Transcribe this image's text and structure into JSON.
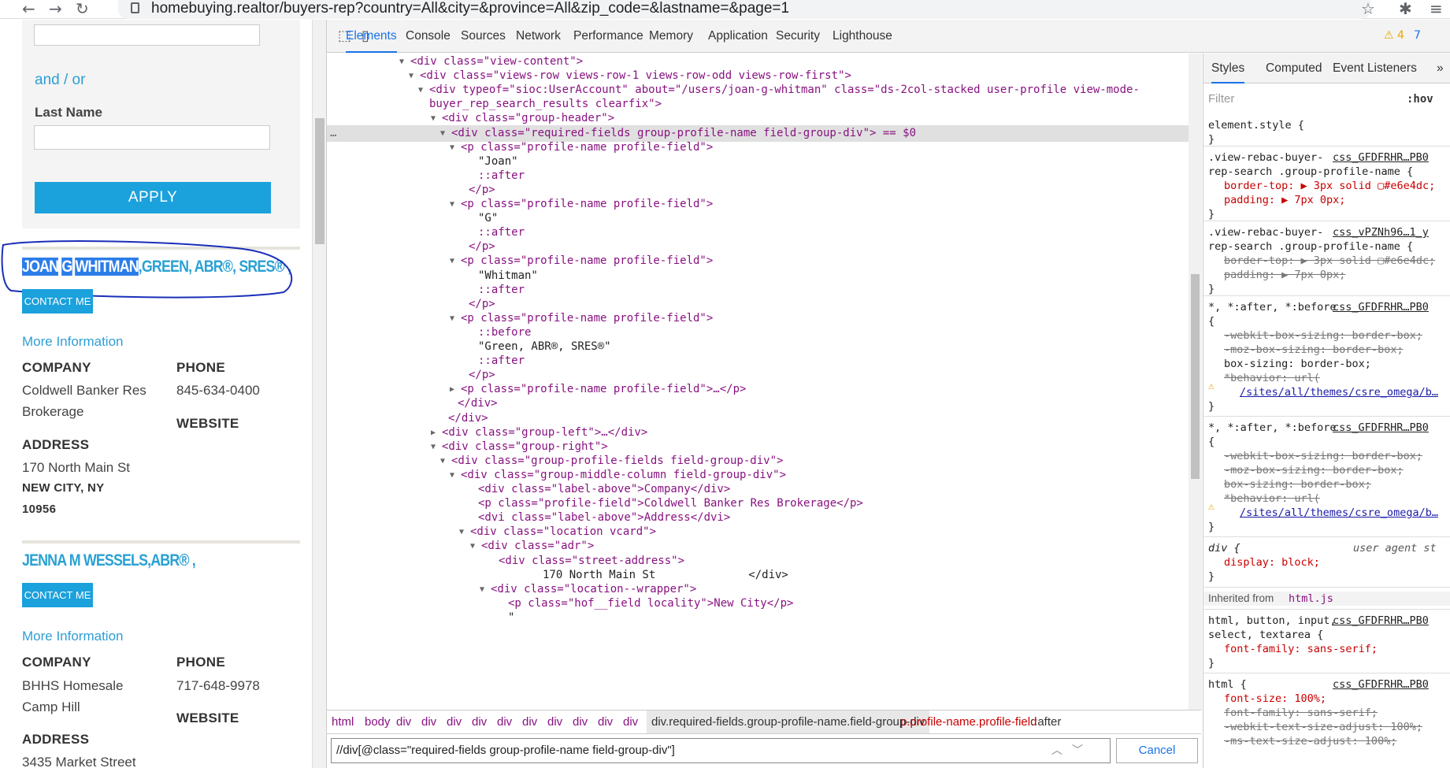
{
  "browser": {
    "url": "homebuying.realtor/buyers-rep?country=All&city=&province=All&zip_code=&lastname=&page=1",
    "back_icon": "←",
    "forward_icon": "→",
    "reload_icon": "↻",
    "star_icon": "☆",
    "ext_icon": "✱",
    "menu_icon": "≡"
  },
  "page": {
    "and_or": "and / or",
    "last_name_label": "Last Name",
    "apply_label": "APPLY",
    "agents": [
      {
        "name_highlight": [
          "JOAN",
          "G",
          "WHITMAN"
        ],
        "name_rest": ",GREEN, ABR®, SRES® ,",
        "contact_label": "CONTACT ME",
        "more_info": "More Information",
        "company_hd": "COMPANY",
        "company_line1": "Coldwell Banker Res",
        "company_line2": "Brokerage",
        "phone_hd": "PHONE",
        "phone": "845-634-0400",
        "website_hd": "WEBSITE",
        "address_hd": "ADDRESS",
        "street": "170 North Main St",
        "city": "NEW CITY, NY",
        "zip": "10956"
      },
      {
        "name": "JENNA M WESSELS,ABR® ,",
        "contact_label": "CONTACT ME",
        "more_info": "More Information",
        "company_hd": "COMPANY",
        "company_line1": "BHHS Homesale",
        "company_line2": "Camp Hill",
        "phone_hd": "PHONE",
        "phone": "717-648-9978",
        "website_hd": "WEBSITE",
        "address_hd": "ADDRESS",
        "street": "3435 Market Street"
      }
    ]
  },
  "devtools": {
    "tabs": [
      "Elements",
      "Console",
      "Sources",
      "Network",
      "Performance",
      "Memory",
      "Application",
      "Security",
      "Lighthouse"
    ],
    "warn_count": "⚠ 4",
    "msg_count": "7",
    "dom_lines": [
      "<div class=\"view-content\">",
      "<div class=\"views-row views-row-1 views-row-odd views-row-first\">",
      "<div typeof=\"sioc:UserAccount\" about=\"/users/joan-g-whitman\" class=\"ds-2col-stacked user-profile view-mode-",
      "buyer_rep_search_results clearfix\">",
      "<div class=\"group-header\">",
      "<div class=\"required-fields group-profile-name field-group-div\"> == $0",
      "<p class=\"profile-name profile-field\">",
      "\"Joan\"",
      "::after",
      "</p>",
      "<p class=\"profile-name profile-field\">",
      "\"G\"",
      "::after",
      "</p>",
      "<p class=\"profile-name profile-field\">",
      "\"Whitman\"",
      "::after",
      "</p>",
      "<p class=\"profile-name profile-field\">",
      "::before",
      "\"Green, ABR®, SRES®\"",
      "::after",
      "</p>",
      "<p class=\"profile-name profile-field\">…</p>",
      "</div>",
      "</div>",
      "<div class=\"group-left\">…</div>",
      "<div class=\"group-right\">",
      "<div class=\"group-profile-fields field-group-div\">",
      "<div class=\"group-middle-column field-group-div\">",
      "<div class=\"label-above\">Company</div>",
      "<p class=\"profile-field\">Coldwell Banker Res Brokerage</p>",
      "<dvi class=\"label-above\">Address</dvi>",
      "<div class=\"location vcard\">",
      "<div class=\"adr\">",
      "<div class=\"street-address\">",
      "170 North Main St              </div>",
      "<div class=\"location--wrapper\">",
      "<p class=\"hof__field locality\">New City</p>",
      "\""
    ],
    "ellipsis": "…",
    "breadcrumbs": [
      "html",
      "body",
      "div",
      "div",
      "div",
      "div",
      "div",
      "div",
      "div",
      "div",
      "div",
      "div",
      "div.required-fields.group-profile-name.field-group-div",
      "p.profile-name.profile-field",
      "::after"
    ],
    "search_value": "//div[@class=\"required-fields group-profile-name field-group-div\"]",
    "cancel_label": "Cancel",
    "styles_tabs": [
      "Styles",
      "Computed",
      "Event Listeners",
      "»"
    ],
    "filter_placeholder": "Filter",
    "hov": ":hov",
    "styles_lines": [
      "element.style {",
      "}",
      ".view-rebac-buyer-",
      "rep-search .group-profile-name {",
      "border-top: ▶ 3px solid ▢#e6e4dc;",
      "padding: ▶ 7px 0px;",
      "}",
      ".view-rebac-buyer-",
      "rep-search .group-profile-name {",
      "border-top: ▶ 3px solid ▢#e6e4dc;",
      "padding: ▶ 7px 0px;",
      "}",
      "*, *:after, *:before",
      "{",
      "-webkit-box-sizing: border-box;",
      "-moz-box-sizing: border-box;",
      "box-sizing: border-box;",
      "*behavior: url(",
      "/sites/all/themes/csre_omega/b…",
      "}",
      "*, *:after, *:before",
      "{",
      "-webkit-box-sizing: border-box;",
      "-moz-box-sizing: border-box;",
      "box-sizing: border-box;",
      "*behavior: url(",
      "/sites/all/themes/csre_omega/b…",
      "}",
      "div {",
      "display: block;",
      "}",
      "Inherited from",
      "html.js",
      "html, button, input,",
      "select, textarea {",
      "font-family: sans-serif;",
      "}",
      "html {",
      "font-size: 100%;",
      "font-family: sans-serif;",
      "-webkit-text-size-adjust: 100%;",
      "-ms-text-size-adjust: 100%;"
    ],
    "style_sources": [
      "css_GFDFRHR…PB0",
      "css_vPZNh96…1_y",
      "css_GFDFRHR…PB0",
      "css_GFDFRHR…PB0",
      "user agent st",
      "css_GFDFRHR…PB0",
      "css_GFDFRHR…PB0"
    ]
  }
}
